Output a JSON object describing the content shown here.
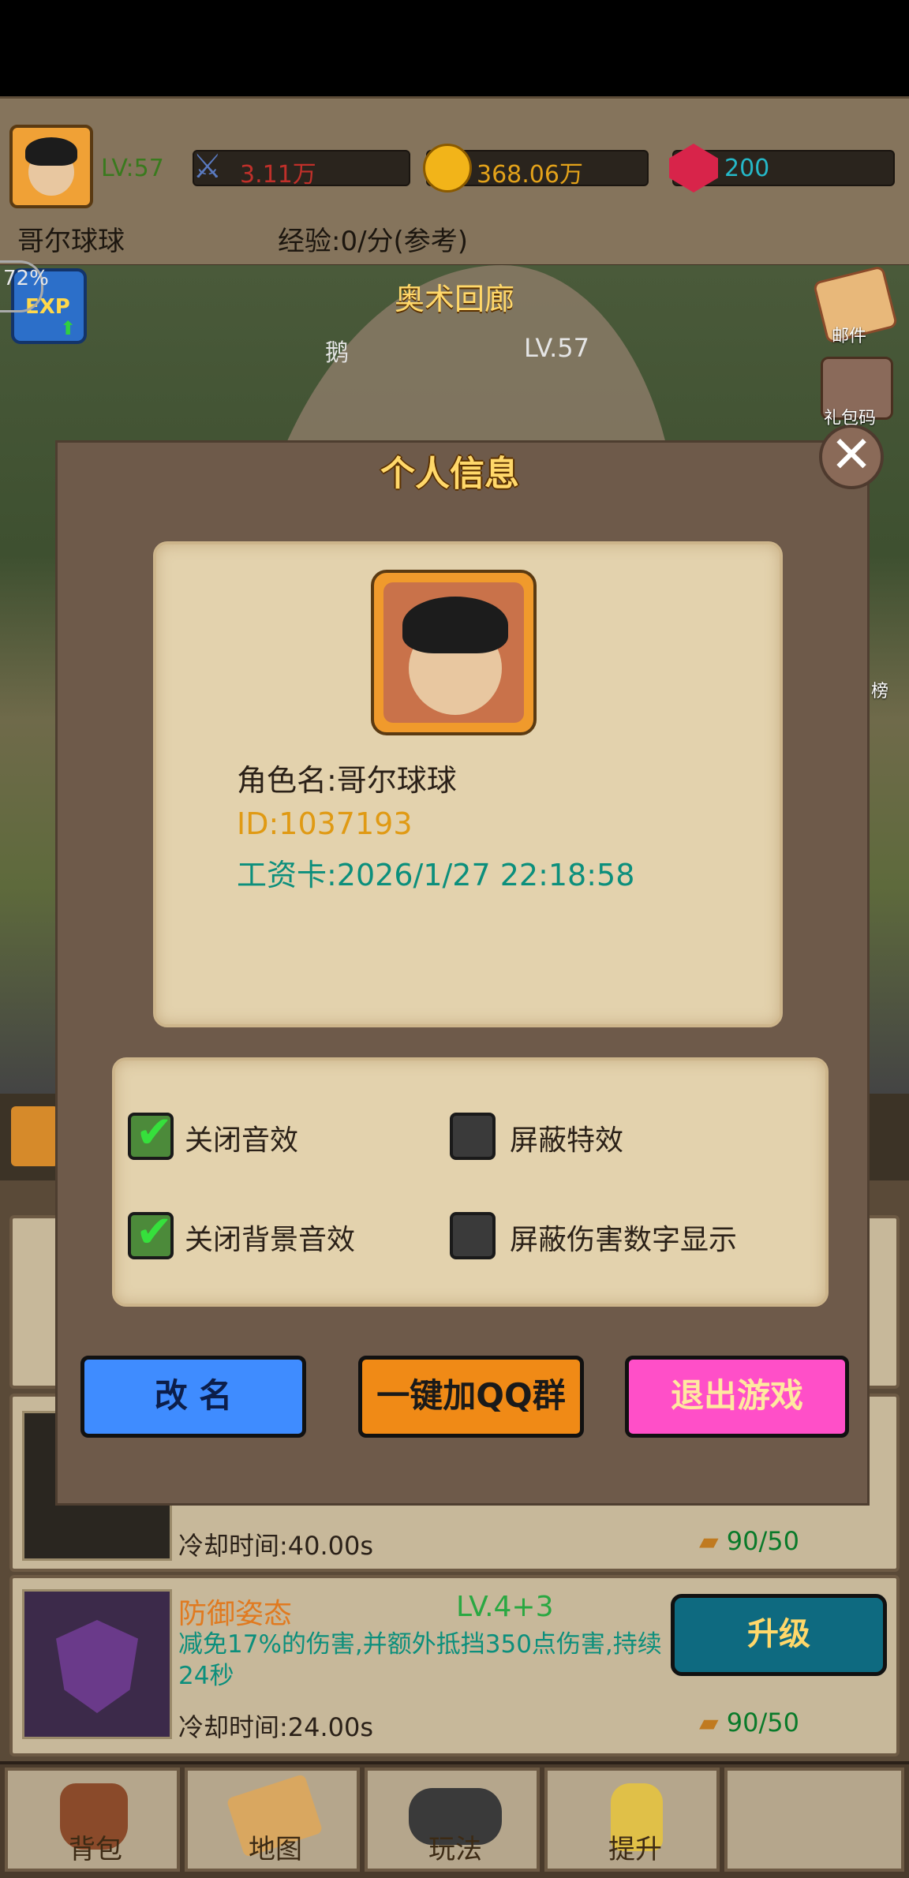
{
  "header": {
    "level": "LV:57",
    "player_name": "哥尔球球",
    "power": "3.11万",
    "gold": "368.06万",
    "gems": "200",
    "exp_info": "经验:0/分(参考)"
  },
  "scene": {
    "exp_badge_percent": "72%",
    "exp_badge_label": "EXP",
    "map_name": "奥术回廊",
    "npc_name": "鹅",
    "npc_level": "LV.57",
    "side_mail": "邮件",
    "side_gift": "礼包码",
    "side_rank_partial": "榜"
  },
  "modal": {
    "title": "个人信息",
    "role_name": "角色名:哥尔球球",
    "id": "ID:1037193",
    "wage_card": "工资卡:2026/1/27 22:18:58",
    "settings": [
      {
        "label": "关闭音效",
        "checked": true
      },
      {
        "label": "屏蔽特效",
        "checked": false
      },
      {
        "label": "关闭背景音效",
        "checked": true
      },
      {
        "label": "屏蔽伤害数字显示",
        "checked": false
      }
    ],
    "buttons": {
      "rename": "改 名",
      "join_qq": "一键加QQ群",
      "exit": "退出游戏"
    }
  },
  "skills": [
    {
      "cooldown": "冷却时间:40.00s",
      "cost": "90/50"
    },
    {
      "name": "防御姿态",
      "level": "LV.4+3",
      "description": "减免17%的伤害,并额外抵挡350点伤害,持续24秒",
      "cooldown": "冷却时间:24.00s",
      "cost": "90/50",
      "button": "升级"
    }
  ],
  "nav": [
    "背包",
    "地图",
    "玩法",
    "提升"
  ],
  "colors": {
    "modal_bg": "#6e5a4a",
    "parchment": "#e3d2ad",
    "rename_btn": "#3f8cff",
    "qq_btn": "#f08a16",
    "exit_btn": "#ff4fc8",
    "title_gold": "#ffd86a",
    "teal_text": "#0c8f7c"
  }
}
